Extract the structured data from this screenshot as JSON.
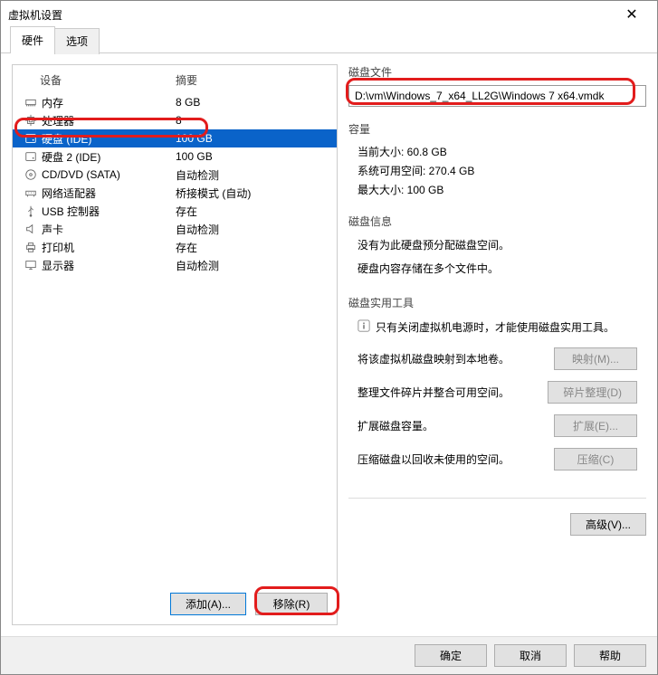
{
  "window": {
    "title": "虚拟机设置",
    "close": "✕"
  },
  "tabs": {
    "hardware": "硬件",
    "options": "选项"
  },
  "headers": {
    "device": "设备",
    "summary": "摘要"
  },
  "devices": [
    {
      "name": "内存",
      "summary": "8 GB",
      "icon": "memory"
    },
    {
      "name": "处理器",
      "summary": "8",
      "icon": "cpu"
    },
    {
      "name": "硬盘 (IDE)",
      "summary": "100 GB",
      "icon": "disk",
      "selected": true
    },
    {
      "name": "硬盘 2 (IDE)",
      "summary": "100 GB",
      "icon": "disk"
    },
    {
      "name": "CD/DVD (SATA)",
      "summary": "自动检测",
      "icon": "cd"
    },
    {
      "name": "网络适配器",
      "summary": "桥接模式 (自动)",
      "icon": "net"
    },
    {
      "name": "USB 控制器",
      "summary": "存在",
      "icon": "usb"
    },
    {
      "name": "声卡",
      "summary": "自动检测",
      "icon": "sound"
    },
    {
      "name": "打印机",
      "summary": "存在",
      "icon": "printer"
    },
    {
      "name": "显示器",
      "summary": "自动检测",
      "icon": "display"
    }
  ],
  "left_buttons": {
    "add": "添加(A)...",
    "remove": "移除(R)"
  },
  "right": {
    "disk_file": {
      "title": "磁盘文件",
      "path": "D:\\vm\\Windows_7_x64_LL2G\\Windows 7 x64.vmdk"
    },
    "capacity": {
      "title": "容量",
      "current": "当前大小: 60.8 GB",
      "free": "系统可用空间: 270.4 GB",
      "max": "最大大小: 100 GB"
    },
    "disk_info": {
      "title": "磁盘信息",
      "line1": "没有为此硬盘预分配磁盘空间。",
      "line2": "硬盘内容存储在多个文件中。"
    },
    "utilities": {
      "title": "磁盘实用工具",
      "hint": "只有关闭虚拟机电源时，才能使用磁盘实用工具。",
      "map_text": "将该虚拟机磁盘映射到本地卷。",
      "map_btn": "映射(M)...",
      "defrag_text": "整理文件碎片并整合可用空间。",
      "defrag_btn": "碎片整理(D)",
      "expand_text": "扩展磁盘容量。",
      "expand_btn": "扩展(E)...",
      "compact_text": "压缩磁盘以回收未使用的空间。",
      "compact_btn": "压缩(C)"
    },
    "advanced": "高级(V)..."
  },
  "bottom": {
    "ok": "确定",
    "cancel": "取消",
    "help": "帮助"
  }
}
